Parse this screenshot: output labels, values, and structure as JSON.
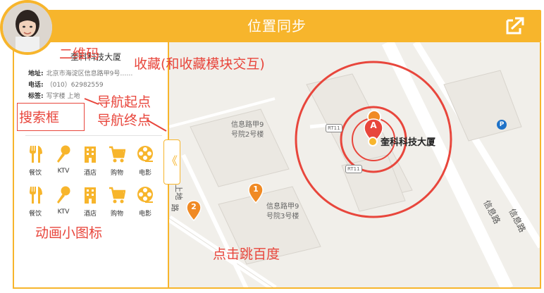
{
  "header": {
    "title": "位置同步",
    "sync_icon": "share-arrow-icon"
  },
  "colors": {
    "accent": "#f7b52c",
    "annotation": "#e8463c",
    "map_bg": "#f1efea"
  },
  "poi": {
    "name": "奎科科技大厦",
    "rows": [
      {
        "key": "地址:",
        "value": "北京市海淀区信息路甲9号……"
      },
      {
        "key": "电话:",
        "value": "（010）62982559"
      },
      {
        "key": "标签:",
        "value": "写字楼 上地"
      }
    ]
  },
  "categories": [
    {
      "label": "餐饮",
      "icon": "restaurant-icon"
    },
    {
      "label": "KTV",
      "icon": "microphone-icon"
    },
    {
      "label": "酒店",
      "icon": "hotel-icon"
    },
    {
      "label": "购物",
      "icon": "shopping-cart-icon"
    },
    {
      "label": "电影",
      "icon": "film-reel-icon"
    }
  ],
  "annotations": {
    "qr": "二维码",
    "favorite": "收藏(和收藏模块交互)",
    "nav_start": "导航起点",
    "nav_end": "导航终点",
    "search": "搜索框",
    "anim_icons": "动画小图标",
    "click_jump": "点击跳百度"
  },
  "toggle_label": "《",
  "map": {
    "buildings": [
      {
        "line1": "信息路甲9",
        "line2": "号院2号楼"
      },
      {
        "line1": "信息路甲9",
        "line2": "号院3号楼"
      }
    ],
    "road_labels": [
      "信息路",
      "信息路",
      "上地",
      "路"
    ],
    "road_signs": [
      "RT11",
      "RT11"
    ],
    "parking": "P",
    "marker_a": "A",
    "marker_1": "1",
    "marker_2": "2",
    "poi_label": "奎科科技大厦"
  }
}
